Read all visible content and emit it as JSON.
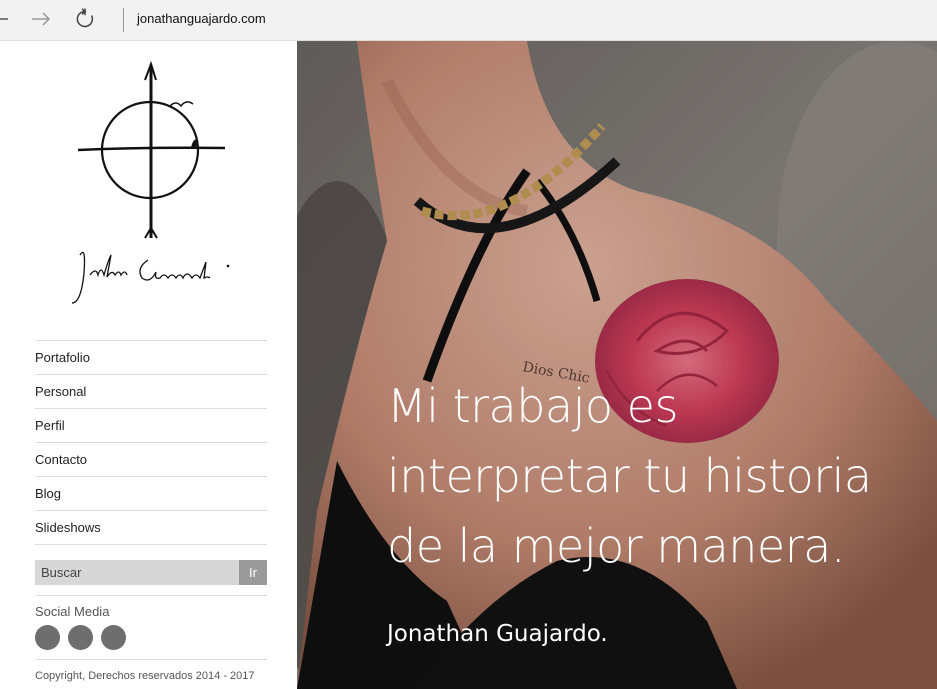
{
  "browser": {
    "address": "jonathanguajardo.com",
    "icons": [
      "back-arrow-icon",
      "forward-arrow-icon",
      "refresh-icon"
    ]
  },
  "sidebar": {
    "logo_text": "Jonathan Guajardo.",
    "menu": [
      {
        "label": "Portafolio"
      },
      {
        "label": "Personal"
      },
      {
        "label": "Perfil"
      },
      {
        "label": "Contacto"
      },
      {
        "label": "Blog"
      },
      {
        "label": "Slideshows"
      }
    ],
    "search": {
      "placeholder": "Buscar",
      "button_label": "Ir"
    },
    "social_title": "Social Media",
    "social_icons": [
      "social-icon-1",
      "social-icon-2",
      "social-icon-3"
    ],
    "copyright": "Copyright, Derechos reservados 2014 - 2017"
  },
  "hero": {
    "tagline": "Mi trabajo es interpretar tu historia de la mejor manera.",
    "name": "Jonathan Guajardo.",
    "tattoo_text": "Dios Chic"
  },
  "colors": {
    "sidebar_bg": "#ffffff",
    "menu_divider": "#dcdcdc",
    "search_bg": "#d7d7d7",
    "search_button": "#9b9b9b",
    "social_circle": "#6e6e6e",
    "rose_tattoo": "#d8415e"
  }
}
